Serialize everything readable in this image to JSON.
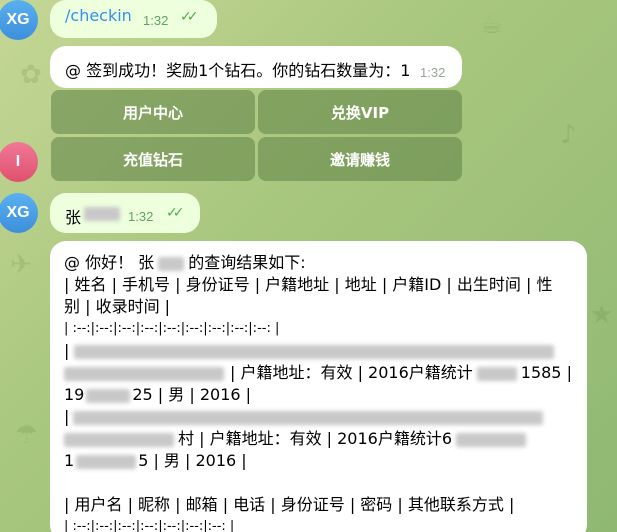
{
  "messages": {
    "m1": {
      "avatar": "XG",
      "text": "/checkin",
      "time": "1:32"
    },
    "m2": {
      "text": "@ 签到成功！奖励1个钻石。你的钻石数量为：1",
      "time": "1:32"
    },
    "keyboard": [
      "用户中心",
      "兑换VIP",
      "充值钻石",
      "邀请赚钱"
    ],
    "i_avatar": "I",
    "m3": {
      "avatar": "XG",
      "text": "张",
      "time": "1:32"
    },
    "m4": {
      "lines": [
        "@ 你好！ 张",
        "的查询结果如下:",
        "| 姓名 | 手机号 | 身份证号 | 户籍地址 | 地址 | 户籍ID | 出生时间 | 性",
        "别 | 收录时间 |",
        "| :--:|:--:|:--:|:--:|:--:|:--:|:--:|:--:|:--: |",
        "| 户籍地址：有效 | 2016户籍统计",
        "1585 |",
        "19",
        "25 | 男 | 2016 |",
        "|",
        "村 | 户籍地址：有效 | 2016户籍统计6",
        "1",
        "5 | 男 | 2016 |",
        "| 用户名 | 昵称 | 邮箱 | 电话 | 身份证号 | 密码 | 其他联系方式 |",
        "| :--:|:--:|:--:|:--:|:--:|:--:|:--: |"
      ]
    }
  },
  "colors": {
    "outgoing": "#eeffde",
    "incoming": "#ffffff",
    "link": "#3390ec",
    "check": "#4fae4e"
  },
  "icons": [
    "double-check-icon",
    "double-check-icon"
  ]
}
